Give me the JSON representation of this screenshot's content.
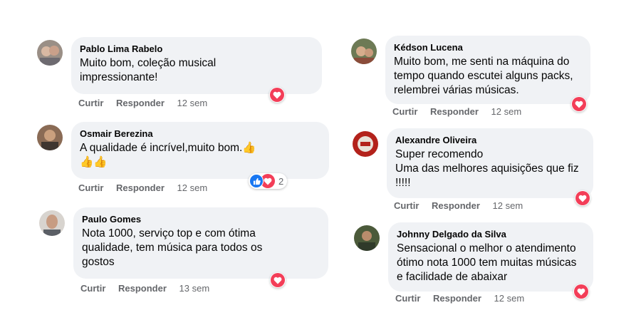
{
  "colors": {
    "bubble": "#f0f2f5",
    "love": "#f33e58",
    "like": "#1877f2",
    "meta": "#65676b"
  },
  "comments": [
    {
      "author": "Pablo Lima Rabelo",
      "lines": [
        "Muito bom, coleção musical",
        "impressionante!"
      ],
      "actions": {
        "like": "Curtir",
        "reply": "Responder",
        "time": "12 sem"
      },
      "reactions": [
        "love-icon"
      ]
    },
    {
      "author": "Osmair Berezina",
      "lines": [
        "A qualidade é incrível,muito bom.👍",
        "👍👍"
      ],
      "actions": {
        "like": "Curtir",
        "reply": "Responder",
        "time": "12 sem"
      },
      "reactions": [
        "like-icon",
        "love-icon"
      ],
      "reaction_count": "2"
    },
    {
      "author": "Paulo Gomes",
      "lines": [
        "Nota 1000, serviço top e com ótima",
        "qualidade, tem música para todos os",
        "gostos"
      ],
      "actions": {
        "like": "Curtir",
        "reply": "Responder",
        "time": "13 sem"
      },
      "reactions": [
        "love-icon"
      ]
    },
    {
      "author": "Kédson Lucena",
      "lines": [
        "Muito bom, me senti na máquina do",
        "tempo quando escutei alguns packs,",
        "relembrei várias músicas."
      ],
      "actions": {
        "like": "Curtir",
        "reply": "Responder",
        "time": "12 sem"
      },
      "reactions": [
        "love-icon"
      ]
    },
    {
      "author": "Alexandre Oliveira",
      "lines": [
        "Super recomendo",
        "Uma das melhores aquisições que fiz",
        "!!!!!"
      ],
      "actions": {
        "like": "Curtir",
        "reply": "Responder",
        "time": "12 sem"
      },
      "reactions": [
        "love-icon"
      ]
    },
    {
      "author": "Johnny Delgado da Silva",
      "lines": [
        "Sensacional o melhor o atendimento",
        "ótimo nota 1000 tem muitas músicas",
        "e facilidade de abaixar"
      ],
      "actions": {
        "like": "Curtir",
        "reply": "Responder",
        "time": "12 sem"
      },
      "reactions": [
        "love-icon"
      ]
    }
  ]
}
